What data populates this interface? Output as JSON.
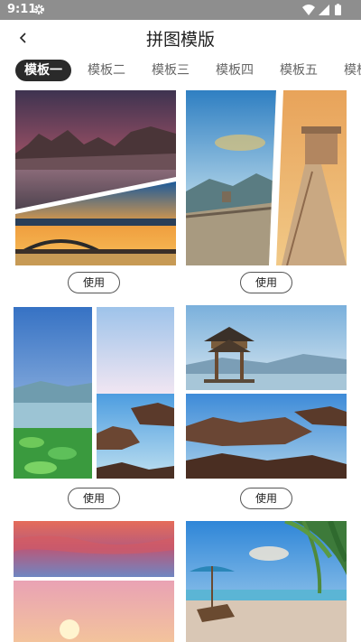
{
  "status_bar": {
    "time": "9:11",
    "icons": [
      "gear-icon",
      "wifi-icon",
      "signal-icon",
      "battery-icon"
    ],
    "background": "#8e8e8e"
  },
  "header": {
    "back_icon": "chevron-left-icon",
    "title": "拼图模版"
  },
  "tabs": [
    {
      "label": "模板一",
      "active": true
    },
    {
      "label": "模板二",
      "active": false
    },
    {
      "label": "模板三",
      "active": false
    },
    {
      "label": "模板四",
      "active": false
    },
    {
      "label": "模板五",
      "active": false
    },
    {
      "label": "模板",
      "active": false
    }
  ],
  "templates": [
    {
      "use_label": "使用"
    },
    {
      "use_label": "使用"
    },
    {
      "use_label": "使用"
    },
    {
      "use_label": "使用"
    },
    {
      "use_label": null
    },
    {
      "use_label": null
    }
  ],
  "colors": {
    "active_tab": "#2a2a2a",
    "inactive_tab_text": "#666666",
    "button_border": "#555555"
  }
}
